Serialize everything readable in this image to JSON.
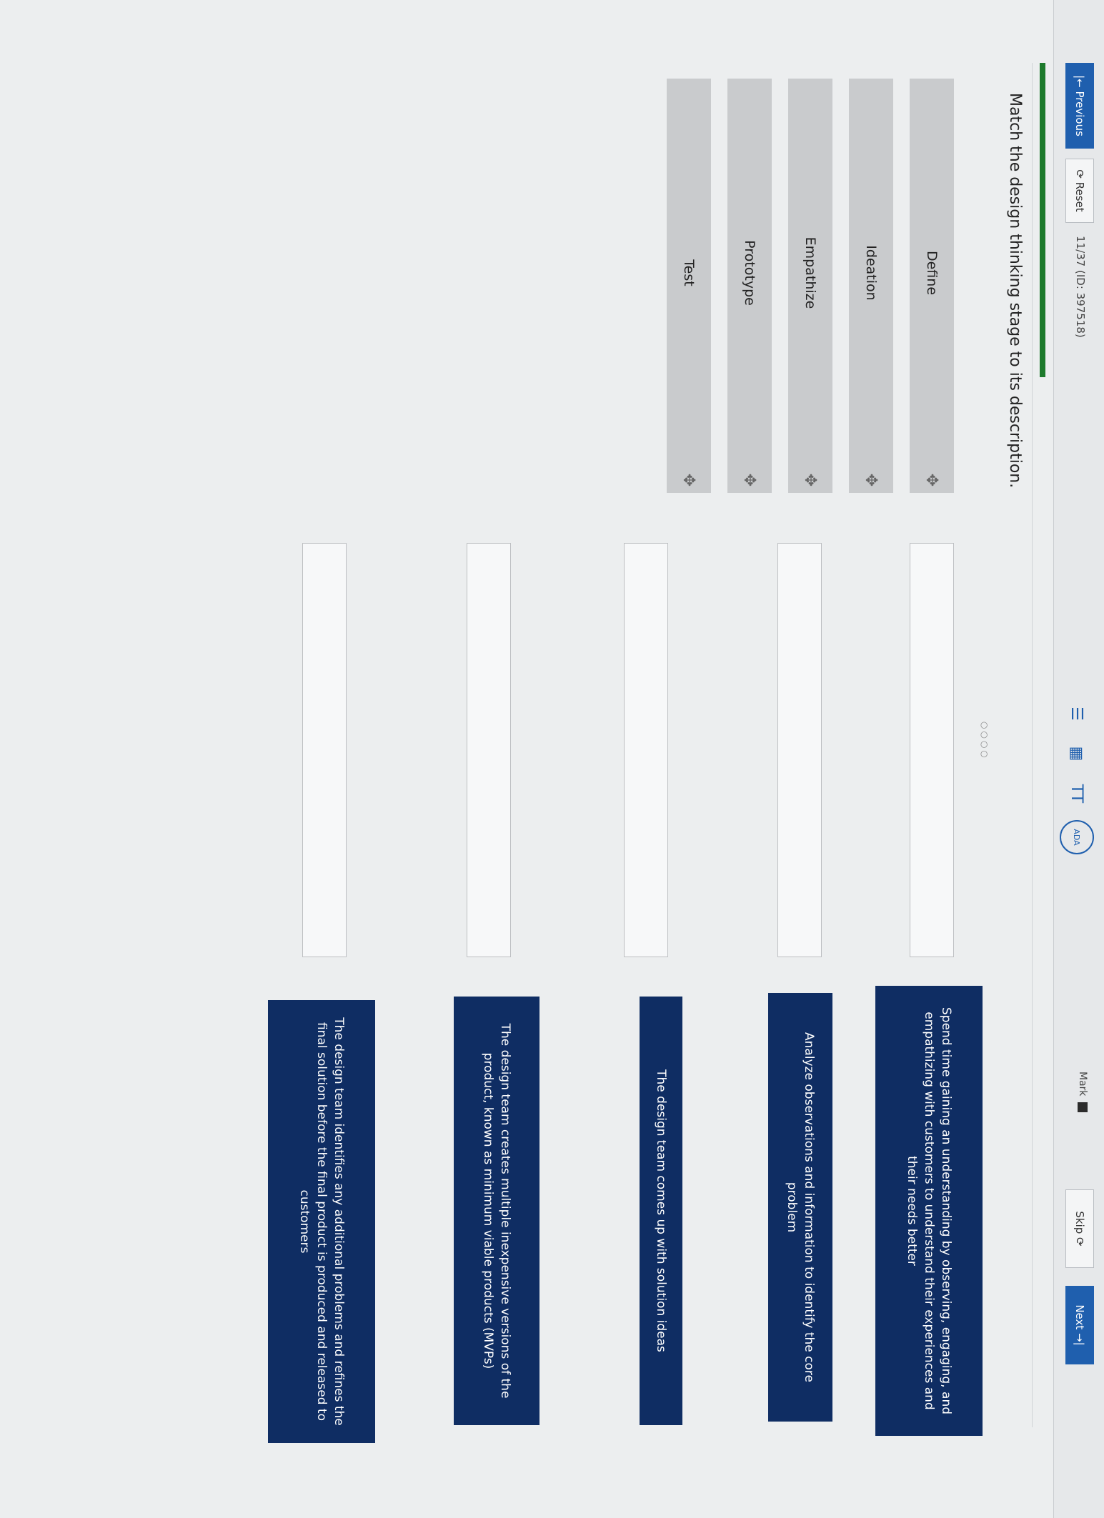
{
  "nav": {
    "previous_label": "|← Previous",
    "reset_label": "⟳ Reset",
    "progress": "11/37 (ID: 397518)",
    "mark_label": "Mark",
    "skip_label": "Skip ⟳",
    "next_label": "Next →|"
  },
  "tools": {
    "list_icon": "☰",
    "calc_icon": "▦",
    "text_size_icon": "TT",
    "ada_label": "ADA"
  },
  "question": {
    "instruction": "Match the design thinking stage to its description.",
    "dots": "○○○○"
  },
  "stages": [
    {
      "label": "Define"
    },
    {
      "label": "Ideation"
    },
    {
      "label": "Empathize"
    },
    {
      "label": "Prototype"
    },
    {
      "label": "Test"
    }
  ],
  "descriptions": [
    {
      "text": "Spend time gaining an understanding by observing, engaging, and empathizing with customers to understand their experiences and their needs better"
    },
    {
      "text": "Analyze observations and information to identify the core problem"
    },
    {
      "text": "The design team comes up with solution ideas"
    },
    {
      "text": "The design team creates multiple inexpensive versions of the product, known as minimum viable products (MVPs)"
    },
    {
      "text": "The design team identifies any additional problems and refines the final solution before the final product is produced and released to customers"
    }
  ],
  "colors": {
    "accent": "#1f5fae",
    "description_bg": "#0f2d63",
    "progress_green": "#1d7a2c"
  }
}
